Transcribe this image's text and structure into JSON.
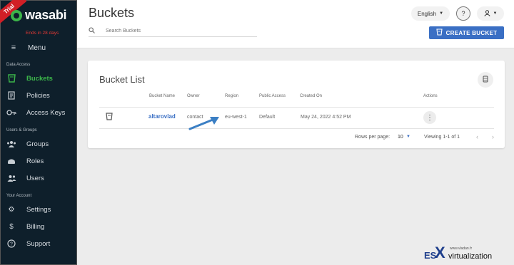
{
  "brand": {
    "ribbon": "Trial",
    "name": "wasabi",
    "trial_notice": "Ends in 28 days"
  },
  "sidebar": {
    "menu_label": "Menu",
    "sections": [
      {
        "label": "Data Access"
      },
      {
        "label": "Users & Groups"
      },
      {
        "label": "Your Account"
      }
    ],
    "items": [
      {
        "label": "Buckets",
        "icon": "bucket-icon",
        "active": true
      },
      {
        "label": "Policies",
        "icon": "document-icon"
      },
      {
        "label": "Access Keys",
        "icon": "key-icon"
      },
      {
        "label": "Groups",
        "icon": "group-icon"
      },
      {
        "label": "Roles",
        "icon": "role-icon"
      },
      {
        "label": "Users",
        "icon": "users-icon"
      },
      {
        "label": "Settings",
        "icon": "gear-icon"
      },
      {
        "label": "Billing",
        "icon": "dollar-icon"
      },
      {
        "label": "Support",
        "icon": "help-circle-icon"
      }
    ]
  },
  "header": {
    "title": "Buckets",
    "search_placeholder": "Search Buckets",
    "language": "English",
    "create_button": "CREATE BUCKET"
  },
  "bucket_list": {
    "title": "Bucket List",
    "columns": [
      "Bucket Name",
      "Owner",
      "Region",
      "Public Access",
      "Created On",
      "Actions"
    ],
    "rows": [
      {
        "name": "altarovlad",
        "owner": "contact",
        "region": "eu-west-1",
        "public_access": "Default",
        "created_on": "May 24, 2022 4:52 PM"
      }
    ],
    "pagination": {
      "rows_per_page_label": "Rows per page:",
      "rows_per_page": "10",
      "range": "Viewing 1-1 of 1"
    }
  },
  "watermark": {
    "url": "www.vladan.fr",
    "prefix": "ES",
    "x": "X",
    "suffix": "virtualization"
  },
  "colors": {
    "sidebar_bg": "#0e1f2b",
    "accent_green": "#3cb64a",
    "primary_blue": "#3a6fc4",
    "trial_red": "#d11f26"
  }
}
